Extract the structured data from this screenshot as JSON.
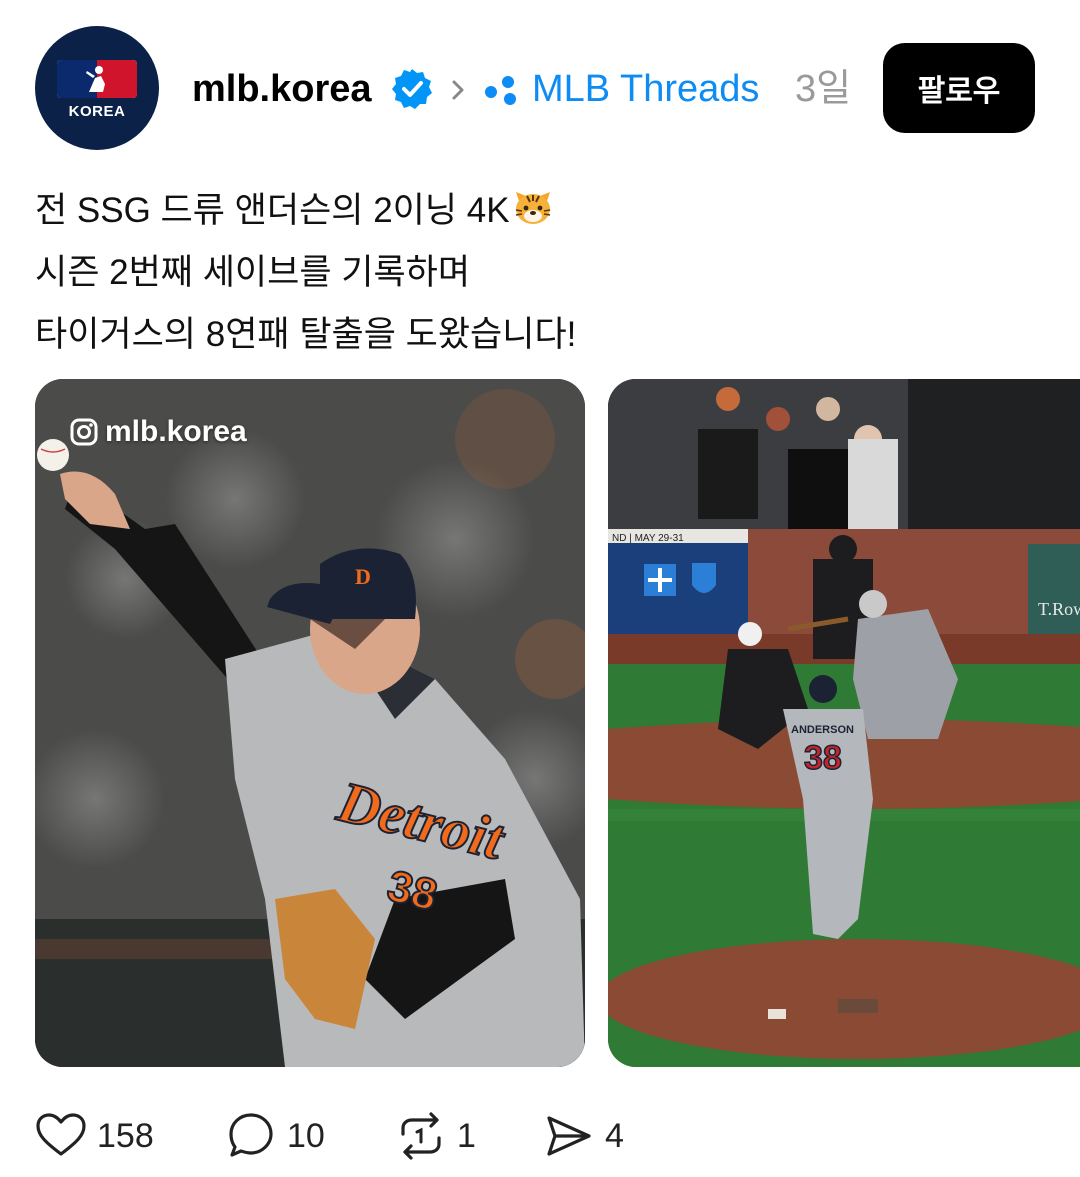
{
  "header": {
    "avatar_text": "KOREA",
    "username": "mlb.korea",
    "community": "MLB Threads",
    "time_ago": "3일",
    "follow_label": "팔로우"
  },
  "post": {
    "lines": [
      "전 SSG 드류 앤더슨의 2이닝 4K",
      "시즌 2번째 세이브를 기록하며",
      "타이거스의 8연패 탈출을 도왔습니다!"
    ],
    "emoji": "tiger-face"
  },
  "media": [
    {
      "watermark": "mlb.korea",
      "jersey_text": "Detroit",
      "jersey_number": "38"
    },
    {
      "signage": "T.Row",
      "scoreboard": "ND | MAY 29-31",
      "player_name": "ANDERSON",
      "player_number": "38"
    }
  ],
  "actions": {
    "likes": "158",
    "comments": "10",
    "reposts": "1",
    "shares": "4"
  },
  "colors": {
    "accent_blue": "#0c8cf4",
    "verified_blue": "#0095f6",
    "follow_bg": "#000000",
    "muted": "#9a9a9a"
  }
}
